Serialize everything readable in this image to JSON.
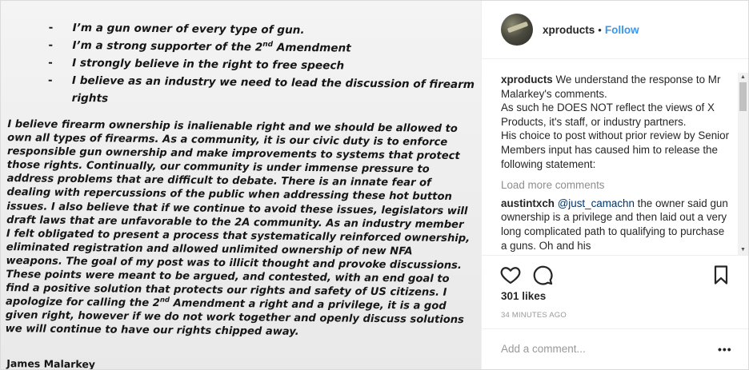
{
  "post_image": {
    "bullets": [
      {
        "text": "I’m a gun owner of every type of gun."
      },
      {
        "text_before": "I’m a strong supporter of the 2",
        "sup": "nd",
        "text_after": " Amendment"
      },
      {
        "text": "I strongly believe in the right to free speech"
      },
      {
        "text": "I believe as an industry we need to lead the discussion of firearm rights"
      }
    ],
    "paragraph_part1": "I believe firearm ownership is inalienable right and we should be allowed to own all types of firearms. As a community, it is our civic duty is to enforce responsible gun ownership and make improvements to systems that protect those rights.  Continually, our community is under immense pressure to address problems that are difficult to debate.  There is an innate fear of dealing with repercussions of the public when addressing these hot button issues.  I also believe that if we continue to avoid these issues, legislators will draft laws that are unfavorable to the 2A community.  As an industry member I felt obligated to present a process that systematically reinforced ownership, eliminated registration and allowed unlimited ownership of new NFA weapons. The goal of my post was to illicit thought and provoke discussions. These points were meant to be argued, and contested, with an end goal to find a positive solution that protects our rights and safety of US citizens. I apologize for calling the 2",
    "paragraph_sup": "nd",
    "paragraph_part2": " Amendment a right and a privilege, it is a god given right, however if we do not work together and openly discuss solutions we will continue to have our rights chipped away.",
    "signature": "James Malarkey"
  },
  "header": {
    "username": "xproducts",
    "separator": "•",
    "follow_label": "Follow"
  },
  "comments": {
    "caption": {
      "username": "xproducts",
      "lines": [
        "We understand the response to Mr Malarkey's comments.",
        "As such he DOES NOT reflect the views of X Products, it's staff, or industry partners.",
        "His choice to post without prior review by Senior Members input has caused him to release the following statement:"
      ]
    },
    "load_more": "Load more comments",
    "items": [
      {
        "username": "austintxch",
        "mention": "@just_camachn",
        "text": " the owner said gun ownership is a privilege and then laid out a very long complicated path to qualifying to purchase a guns. Oh and his"
      }
    ]
  },
  "actions": {
    "icons": [
      "heart-icon",
      "comment-icon",
      "bookmark-icon"
    ]
  },
  "likes": "301 likes",
  "timestamp": "34 MINUTES AGO",
  "add_comment": {
    "placeholder": "Add a comment...",
    "more": "•••"
  },
  "colors": {
    "link_blue": "#3897f0",
    "text": "#262626",
    "muted": "#8e8e8e",
    "border": "#efefef"
  }
}
